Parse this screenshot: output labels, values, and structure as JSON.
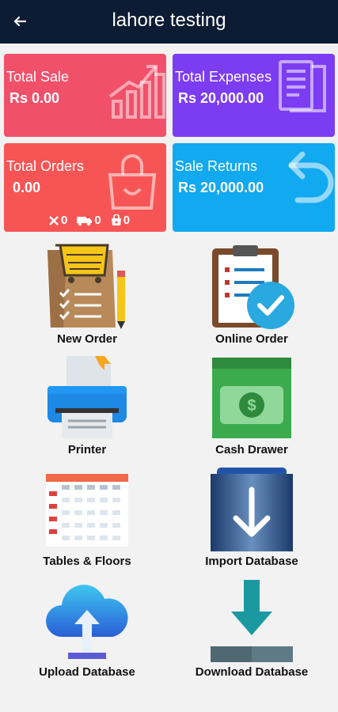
{
  "header": {
    "title": "lahore testing"
  },
  "cards": {
    "total_sale": {
      "label": "Total Sale",
      "value": "Rs 0.00"
    },
    "total_expenses": {
      "label": "Total Expenses",
      "value": "Rs 20,000.00"
    },
    "total_orders": {
      "label": "Total Orders",
      "value": "0.00",
      "cancelled": "0",
      "delivery": "0",
      "takeaway": "0"
    },
    "sale_returns": {
      "label": "Sale Returns",
      "value": "Rs 20,000.00"
    }
  },
  "menu": {
    "new_order": "New Order",
    "online_order": "Online Order",
    "printer": "Printer",
    "cash_drawer": "Cash Drawer",
    "tables_floors": "Tables & Floors",
    "import_database": "Import Database",
    "upload_database": "Upload Database",
    "download_database": "Download Database"
  },
  "colors": {
    "appbar": "#0d1b33",
    "total_sale": "#f1506b",
    "total_expenses": "#7c3cf2",
    "total_orders": "#f75555",
    "sale_returns": "#11a9f0"
  },
  "icons": [
    "back-arrow-icon",
    "growth-chart-icon",
    "receipt-icon",
    "shopping-bag-icon",
    "return-arrow-icon",
    "cancel-icon",
    "delivery-truck-icon",
    "takeaway-bag-icon",
    "order-clipboard-icon",
    "online-order-icon",
    "printer-icon",
    "cash-icon",
    "tables-grid-icon",
    "import-icon",
    "upload-cloud-icon",
    "download-icon"
  ]
}
